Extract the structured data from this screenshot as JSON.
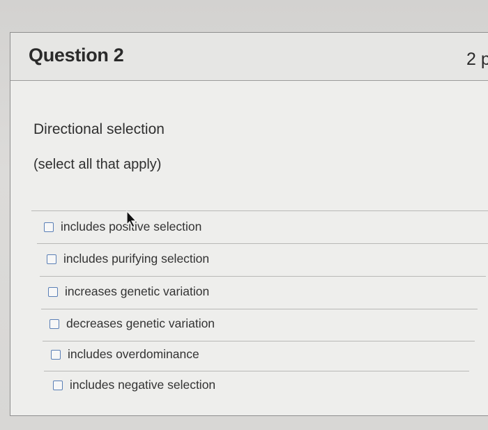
{
  "question": {
    "title": "Question 2",
    "points": "2 p",
    "prompt": "Directional selection",
    "instruction": "(select all that apply)"
  },
  "options": [
    {
      "label": "includes positive selection",
      "checked": false
    },
    {
      "label": "includes purifying selection",
      "checked": false
    },
    {
      "label": "increases genetic variation",
      "checked": false
    },
    {
      "label": "decreases genetic variation",
      "checked": false
    },
    {
      "label": "includes overdominance",
      "checked": false
    },
    {
      "label": "includes negative selection",
      "checked": false
    }
  ],
  "icons": {
    "checkbox": "checkbox-icon",
    "cursor": "mouse-pointer-icon"
  },
  "colors": {
    "checkbox_border": "#5a7fb6",
    "card_background": "#eeeeec",
    "header_background": "#e6e6e4",
    "text": "#2f2f2f"
  }
}
